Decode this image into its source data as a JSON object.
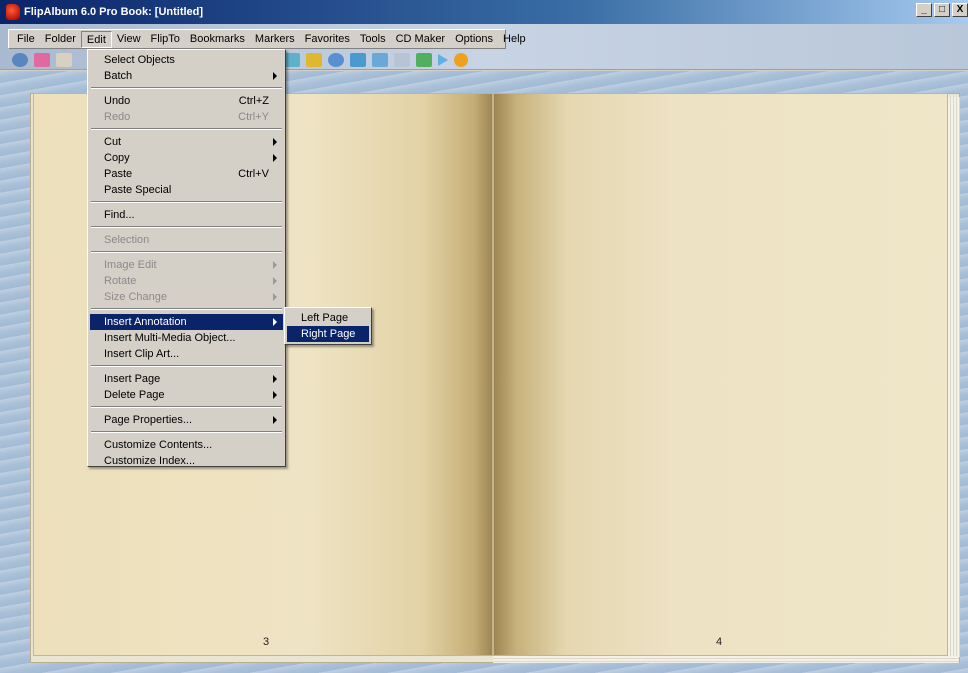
{
  "window": {
    "title": "FlipAlbum 6.0 Pro   Book: [Untitled]",
    "min_label": "_",
    "max_label": "□",
    "close_label": "X"
  },
  "menubar": {
    "items": [
      {
        "label": "File"
      },
      {
        "label": "Folder"
      },
      {
        "label": "Edit"
      },
      {
        "label": "View"
      },
      {
        "label": "FlipTo"
      },
      {
        "label": "Bookmarks"
      },
      {
        "label": "Markers"
      },
      {
        "label": "Favorites"
      },
      {
        "label": "Tools"
      },
      {
        "label": "CD Maker"
      },
      {
        "label": "Options"
      },
      {
        "label": "Help"
      }
    ]
  },
  "toolbar": {
    "icons": [
      {
        "name": "view-icon",
        "color": "#5a86c0"
      },
      {
        "name": "page-icon",
        "color": "#e06aa0"
      },
      {
        "name": "thumbnail-icon",
        "color": "#d8d0c0"
      },
      {
        "name": "tag-icon",
        "color": "#5fb0c8"
      },
      {
        "name": "grid-icon",
        "color": "#e0b830"
      },
      {
        "name": "clock-icon",
        "color": "#5a90d0"
      },
      {
        "name": "insert-icon",
        "color": "#4a9ad0"
      },
      {
        "name": "photo-icon",
        "color": "#6aa8d8"
      },
      {
        "name": "film-icon",
        "color": "#b8c4d4"
      },
      {
        "name": "tree-icon",
        "color": "#50b060"
      },
      {
        "name": "play-icon",
        "color": "#60b0e0"
      },
      {
        "name": "record-icon",
        "color": "#f0a020"
      }
    ]
  },
  "edit_menu": {
    "items": [
      {
        "label": "Select Objects",
        "shortcut": "",
        "submenu": false,
        "disabled": false
      },
      {
        "label": "Batch",
        "shortcut": "",
        "submenu": true,
        "disabled": false
      },
      {
        "sep": true
      },
      {
        "label": "Undo",
        "shortcut": "Ctrl+Z",
        "submenu": false,
        "disabled": false
      },
      {
        "label": "Redo",
        "shortcut": "Ctrl+Y",
        "submenu": false,
        "disabled": true
      },
      {
        "sep": true
      },
      {
        "label": "Cut",
        "shortcut": "",
        "submenu": true,
        "disabled": false
      },
      {
        "label": "Copy",
        "shortcut": "",
        "submenu": true,
        "disabled": false
      },
      {
        "label": "Paste",
        "shortcut": "Ctrl+V",
        "submenu": false,
        "disabled": false
      },
      {
        "label": "Paste Special",
        "shortcut": "",
        "submenu": false,
        "disabled": false
      },
      {
        "sep": true
      },
      {
        "label": "Find...",
        "shortcut": "",
        "submenu": false,
        "disabled": false
      },
      {
        "sep": true
      },
      {
        "label": "Selection",
        "shortcut": "",
        "submenu": false,
        "disabled": true
      },
      {
        "sep": true
      },
      {
        "label": "Image Edit",
        "shortcut": "",
        "submenu": true,
        "disabled": true
      },
      {
        "label": "Rotate",
        "shortcut": "",
        "submenu": true,
        "disabled": true
      },
      {
        "label": "Size Change",
        "shortcut": "",
        "submenu": true,
        "disabled": true
      },
      {
        "sep": true
      },
      {
        "label": "Insert Annotation",
        "shortcut": "",
        "submenu": true,
        "disabled": false,
        "highlighted": true
      },
      {
        "label": "Insert Multi-Media Object...",
        "shortcut": "",
        "submenu": false,
        "disabled": false
      },
      {
        "label": "Insert Clip Art...",
        "shortcut": "",
        "submenu": false,
        "disabled": false
      },
      {
        "sep": true
      },
      {
        "label": "Insert Page",
        "shortcut": "",
        "submenu": true,
        "disabled": false
      },
      {
        "label": "Delete Page",
        "shortcut": "",
        "submenu": true,
        "disabled": false
      },
      {
        "sep": true
      },
      {
        "label": "Page Properties...",
        "shortcut": "",
        "submenu": true,
        "disabled": false
      },
      {
        "sep": true
      },
      {
        "label": "Customize Contents...",
        "shortcut": "",
        "submenu": false,
        "disabled": false
      },
      {
        "label": "Customize Index...",
        "shortcut": "",
        "submenu": false,
        "disabled": false
      }
    ]
  },
  "annotation_submenu": {
    "items": [
      {
        "label": "Left Page",
        "highlighted": false
      },
      {
        "label": "Right Page",
        "highlighted": true
      }
    ]
  },
  "book": {
    "left_page_number": "3",
    "right_page_number": "4"
  }
}
